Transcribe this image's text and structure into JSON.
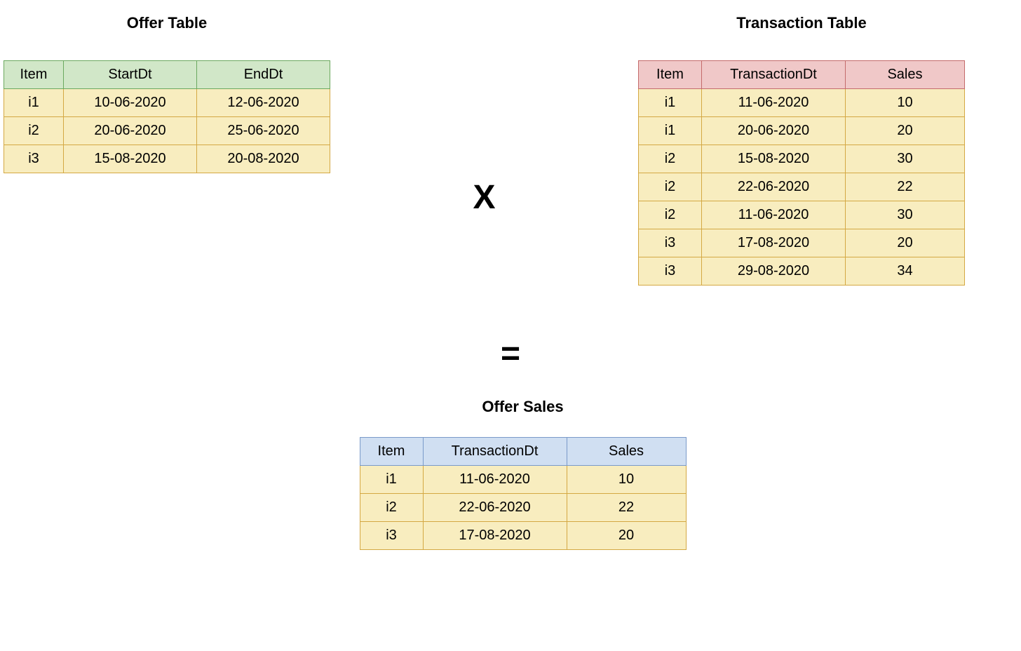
{
  "offer": {
    "title": "Offer Table",
    "headers": [
      "Item",
      "StartDt",
      "EndDt"
    ],
    "rows": [
      [
        "i1",
        "10-06-2020",
        "12-06-2020"
      ],
      [
        "i2",
        "20-06-2020",
        "25-06-2020"
      ],
      [
        "i3",
        "15-08-2020",
        "20-08-2020"
      ]
    ]
  },
  "transaction": {
    "title": "Transaction Table",
    "headers": [
      "Item",
      "TransactionDt",
      "Sales"
    ],
    "rows": [
      [
        "i1",
        "11-06-2020",
        "10"
      ],
      [
        "i1",
        "20-06-2020",
        "20"
      ],
      [
        "i2",
        "15-08-2020",
        "30"
      ],
      [
        "i2",
        "22-06-2020",
        "22"
      ],
      [
        "i2",
        "11-06-2020",
        "30"
      ],
      [
        "i3",
        "17-08-2020",
        "20"
      ],
      [
        "i3",
        "29-08-2020",
        "34"
      ]
    ]
  },
  "result": {
    "title": "Offer Sales",
    "headers": [
      "Item",
      "TransactionDt",
      "Sales"
    ],
    "rows": [
      [
        "i1",
        "11-06-2020",
        "10"
      ],
      [
        "i2",
        "22-06-2020",
        "22"
      ],
      [
        "i3",
        "17-08-2020",
        "20"
      ]
    ]
  },
  "operators": {
    "multiply": "X",
    "equals": "="
  }
}
